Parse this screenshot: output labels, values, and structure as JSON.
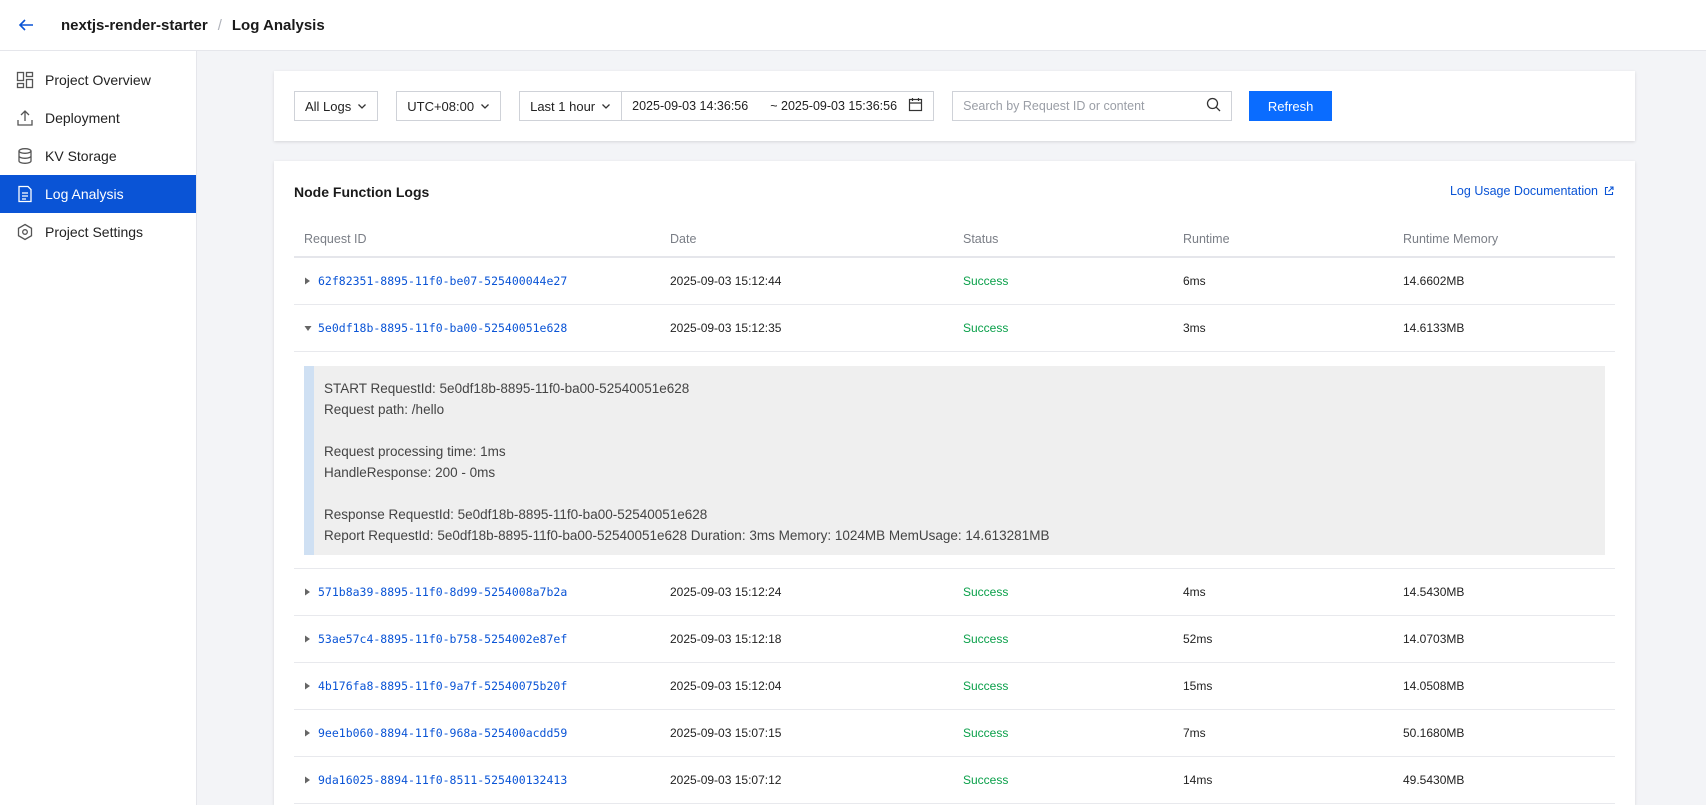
{
  "header": {
    "project": "nextjs-render-starter",
    "separator": "/",
    "page": "Log Analysis"
  },
  "sidebar": {
    "items": [
      {
        "label": "Project Overview",
        "icon": "dashboard-icon",
        "active": false
      },
      {
        "label": "Deployment",
        "icon": "upload-icon",
        "active": false
      },
      {
        "label": "KV Storage",
        "icon": "database-icon",
        "active": false
      },
      {
        "label": "Log Analysis",
        "icon": "document-icon",
        "active": true
      },
      {
        "label": "Project Settings",
        "icon": "settings-icon",
        "active": false
      }
    ]
  },
  "filters": {
    "log_type": "All Logs",
    "timezone": "UTC+08:00",
    "time_range": "Last 1 hour",
    "start": "2025-09-03 14:36:56",
    "end": "~ 2025-09-03 15:36:56",
    "search_placeholder": "Search by Request ID or content",
    "refresh_label": "Refresh"
  },
  "logs": {
    "title": "Node Function Logs",
    "doc_link": "Log Usage Documentation",
    "columns": [
      "Request ID",
      "Date",
      "Status",
      "Runtime",
      "Runtime Memory"
    ],
    "rows": [
      {
        "id": "62f82351-8895-11f0-be07-525400044e27",
        "date": "2025-09-03 15:12:44",
        "status": "Success",
        "runtime": "6ms",
        "memory": "14.6602MB",
        "expanded": false
      },
      {
        "id": "5e0df18b-8895-11f0-ba00-52540051e628",
        "date": "2025-09-03 15:12:35",
        "status": "Success",
        "runtime": "3ms",
        "memory": "14.6133MB",
        "expanded": true
      },
      {
        "id": "571b8a39-8895-11f0-8d99-5254008a7b2a",
        "date": "2025-09-03 15:12:24",
        "status": "Success",
        "runtime": "4ms",
        "memory": "14.5430MB",
        "expanded": false
      },
      {
        "id": "53ae57c4-8895-11f0-b758-5254002e87ef",
        "date": "2025-09-03 15:12:18",
        "status": "Success",
        "runtime": "52ms",
        "memory": "14.0703MB",
        "expanded": false
      },
      {
        "id": "4b176fa8-8895-11f0-9a7f-52540075b20f",
        "date": "2025-09-03 15:12:04",
        "status": "Success",
        "runtime": "15ms",
        "memory": "14.0508MB",
        "expanded": false
      },
      {
        "id": "9ee1b060-8894-11f0-968a-525400acdd59",
        "date": "2025-09-03 15:07:15",
        "status": "Success",
        "runtime": "7ms",
        "memory": "50.1680MB",
        "expanded": false
      },
      {
        "id": "9da16025-8894-11f0-8511-525400132413",
        "date": "2025-09-03 15:07:12",
        "status": "Success",
        "runtime": "14ms",
        "memory": "49.5430MB",
        "expanded": false
      }
    ],
    "detail_lines": [
      "START RequestId: 5e0df18b-8895-11f0-ba00-52540051e628",
      "Request path: /hello",
      "",
      "Request processing time: 1ms",
      "HandleResponse: 200 - 0ms",
      "",
      "Response RequestId: 5e0df18b-8895-11f0-ba00-52540051e628",
      "Report RequestId: 5e0df18b-8895-11f0-ba00-52540051e628 Duration: 3ms Memory: 1024MB MemUsage: 14.613281MB"
    ]
  },
  "colors": {
    "accent": "#0a54d6",
    "button": "#0a6cff",
    "success": "#0aa04a"
  }
}
